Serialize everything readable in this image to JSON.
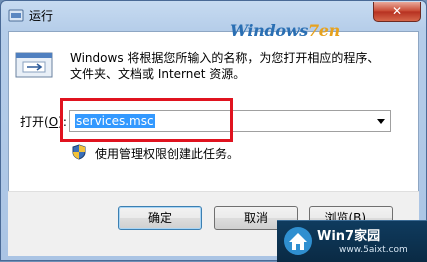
{
  "window": {
    "title": "运行",
    "close_glyph": "✕"
  },
  "logo": {
    "part1": "Windows",
    "part2": "7en"
  },
  "description": {
    "line1": "Windows 将根据您所输入的名称，为您打开相应的程序、",
    "line2": "文件夹、文档或 Internet 资源。"
  },
  "open_field": {
    "label": "打开(",
    "label_access_key": "O",
    "label_suffix": "):",
    "value": "services.msc"
  },
  "admin_note": "使用管理权限创建此任务。",
  "buttons": {
    "ok": "确定",
    "cancel": "取消",
    "browse": "浏览(B)..."
  },
  "watermark": {
    "title": "Win7家园",
    "site": "www.5aixt.com"
  },
  "colors": {
    "highlight": "#e0131f",
    "selection": "#3399ff",
    "title_bar": "#b5cde9"
  }
}
